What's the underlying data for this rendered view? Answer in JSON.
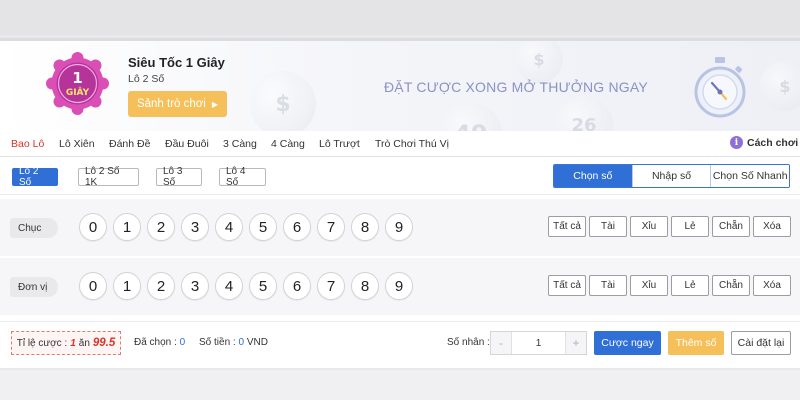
{
  "game": {
    "logo_text_top": "1",
    "logo_text_bottom": "GIÂY",
    "title": "Siêu Tốc 1 Giây",
    "subtitle": "Lô 2 Số",
    "lobby_button": "Sảnh trò chơi",
    "slogan": "ĐẶT CƯỢC XONG MỞ THƯỞNG NGAY"
  },
  "background_ball_numbers": [
    "$",
    "49",
    "26",
    "$",
    "$"
  ],
  "nav": {
    "tabs": [
      "Bao Lô",
      "Lô Xiên",
      "Đánh Đề",
      "Đầu Đuôi",
      "3 Càng",
      "4 Càng",
      "Lô Trượt",
      "Trò Chơi Thú Vị"
    ],
    "active_tab": "Bao Lô",
    "howto_label": "Cách chơi"
  },
  "sub_tabs": [
    "Lô 2 Số",
    "Lô 2 Số 1K",
    "Lô 3 Số",
    "Lô 4 Số"
  ],
  "active_sub_tab": "Lô 2 Số",
  "mode_tabs": [
    "Chọn số",
    "Nhập số",
    "Chọn Số Nhanh"
  ],
  "active_mode": "Chọn số",
  "rows": [
    {
      "label": "Chục",
      "numbers": [
        "0",
        "1",
        "2",
        "3",
        "4",
        "5",
        "6",
        "7",
        "8",
        "9"
      ]
    },
    {
      "label": "Đơn vị",
      "numbers": [
        "0",
        "1",
        "2",
        "3",
        "4",
        "5",
        "6",
        "7",
        "8",
        "9"
      ]
    }
  ],
  "quick_buttons": [
    "Tất cả",
    "Tài",
    "Xỉu",
    "Lẻ",
    "Chẵn",
    "Xóa"
  ],
  "footer": {
    "odds_label": "Tỉ lệ cược :",
    "odds_value": "1",
    "odds_win": "ăn",
    "odds_payout": "99.5",
    "selected_label": "Đã chọn :",
    "selected_value": "0",
    "amount_label": "Số tiền :",
    "amount_value": "0",
    "amount_unit": "VND",
    "multiplier_label": "Số nhân :",
    "multiplier_value": "1",
    "minus": "-",
    "plus": "+",
    "bet_now": "Cược ngay",
    "add_number": "Thêm số",
    "reset": "Cài đặt lại"
  },
  "colors": {
    "primary": "#2f6fd6",
    "accent_gold": "#f5c05a",
    "active_tab_red": "#d9342b",
    "logo_pink": "#d94fb6",
    "slogan": "#8b92c4"
  }
}
